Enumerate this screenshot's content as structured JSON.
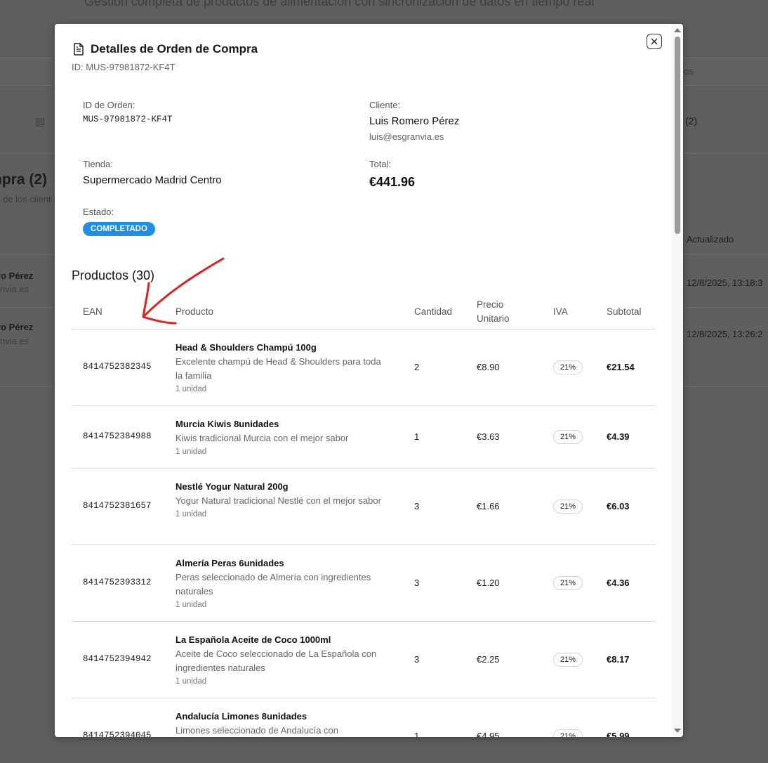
{
  "background": {
    "header_subtitle": "Gestión completa de productos de alimentación con sincronización de datos en tiempo real",
    "tab_fragment_right": "os",
    "counter_fragment": "(2)",
    "section_heading": "npra (2)",
    "section_sub": "de los client",
    "column_updated": "Actualizado",
    "rows": [
      {
        "name": "ro Pérez",
        "email": "nvia.es",
        "date": "12/8/2025, 13:18:3"
      },
      {
        "name": "ro Pérez",
        "email": "nvia.es",
        "date": "12/8/2025, 13:26:2"
      }
    ]
  },
  "modal": {
    "title": "Detalles de Orden de Compra",
    "subtitle": "ID: MUS-97981872-KF4T",
    "fields": {
      "order_id_label": "ID de Orden:",
      "order_id_value": "MUS-97981872-KF4T",
      "customer_label": "Cliente:",
      "customer_name": "Luis Romero Pérez",
      "customer_email": "luis@esgranvia.es",
      "store_label": "Tienda:",
      "store_value": "Supermercado Madrid Centro",
      "total_label": "Total:",
      "total_value": "€441.96",
      "status_label": "Estado:",
      "status_value": "COMPLETADO"
    },
    "products_title": "Productos (30)",
    "columns": [
      "EAN",
      "Producto",
      "Cantidad",
      "Precio\nUnitario",
      "IVA",
      "Subtotal"
    ],
    "col_price_line1": "Precio",
    "col_price_line2": "Unitario",
    "products": [
      {
        "ean": "8414752382345",
        "name": "Head & Shoulders Champú 100g",
        "desc": "Excelente champú de Head & Shoulders para toda la familia",
        "unit": "1 unidad",
        "qty": "2",
        "price": "€8.90",
        "iva": "21%",
        "subtotal": "€21.54"
      },
      {
        "ean": "8414752384988",
        "name": "Murcia Kiwis 8unidades",
        "desc": "Kiwis tradicional Murcia con el mejor sabor",
        "unit": "1 unidad",
        "qty": "1",
        "price": "€3.63",
        "iva": "21%",
        "subtotal": "€4.39"
      },
      {
        "ean": "8414752381657",
        "name": "Nestlé Yogur Natural 200g",
        "desc": "Yogur Natural tradicional Nestlé con el mejor sabor",
        "unit": "1 unidad",
        "qty": "3",
        "price": "€1.66",
        "iva": "21%",
        "subtotal": "€6.03"
      },
      {
        "ean": "8414752393312",
        "name": "Almería Peras 6unidades",
        "desc": "Peras seleccionado de Almería con ingredientes naturales",
        "unit": "1 unidad",
        "qty": "3",
        "price": "€1.20",
        "iva": "21%",
        "subtotal": "€4.36"
      },
      {
        "ean": "8414752394942",
        "name": "La Española Aceite de Coco 1000ml",
        "desc": "Aceite de Coco seleccionado de La Española con ingredientes naturales",
        "unit": "1 unidad",
        "qty": "3",
        "price": "€2.25",
        "iva": "21%",
        "subtotal": "€8.17"
      },
      {
        "ean": "8414752394045",
        "name": "Andalucía Limones 8unidades",
        "desc": "Limones seleccionado de Andalucía con",
        "unit": "",
        "qty": "1",
        "price": "€4.95",
        "iva": "21%",
        "subtotal": "€5.99"
      }
    ]
  },
  "icons": {
    "document": "document-icon",
    "close": "close-icon"
  },
  "colors": {
    "status_badge": "#1f8ee8",
    "annotation": "#e02020"
  }
}
